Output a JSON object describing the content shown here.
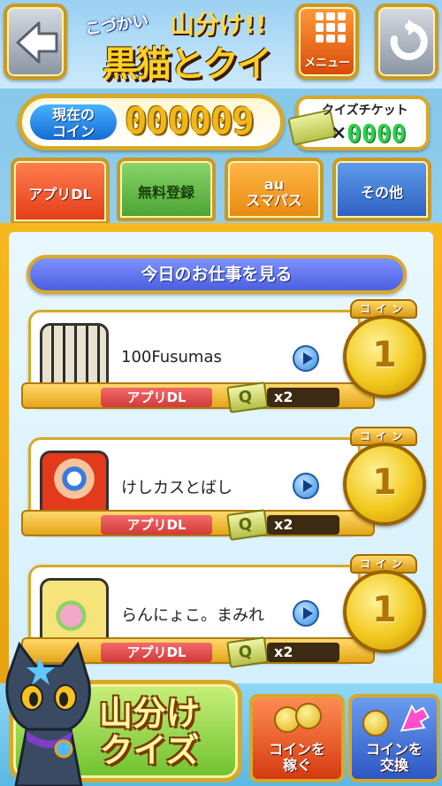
{
  "header": {
    "logo_sub": "こづかい",
    "logo_top": "山分け!!",
    "logo_main": "黒猫とクイズ",
    "menu_label": "メニュー"
  },
  "coins": {
    "label": "現在の\nコイン",
    "label_line1": "現在の",
    "label_line2": "コイン",
    "count": "000009"
  },
  "ticket": {
    "label": "クイズチケット",
    "prefix": "×",
    "count": "0000"
  },
  "tabs": [
    {
      "label": "アプリDL"
    },
    {
      "label": "無料登録"
    },
    {
      "label_line1": "au",
      "label_line2": "スマパス"
    },
    {
      "label": "その他"
    }
  ],
  "today_bar": "今日のお仕事を見る",
  "items": [
    {
      "name": "100Fusumas",
      "tag": "アプリDL",
      "ticket_letter": "Q",
      "reward": "x2",
      "coin_cap": "コイン",
      "coin_value": "1"
    },
    {
      "name": "けしカスとばし",
      "tag": "アプリDL",
      "ticket_letter": "Q",
      "reward": "x2",
      "coin_cap": "コイン",
      "coin_value": "1"
    },
    {
      "name": "らんにょこ。まみれ",
      "tag": "アプリDL",
      "ticket_letter": "Q",
      "reward": "x2",
      "coin_cap": "コイン",
      "coin_value": "1"
    }
  ],
  "footer": {
    "quiz_line1": "山分け",
    "quiz_line2": "クイズ",
    "earn_line1": "コインを",
    "earn_line2": "稼ぐ",
    "exchange_line1": "コインを",
    "exchange_line2": "交換"
  },
  "colors": {
    "gold": "#d7a92a",
    "tab_app": "#e33c18",
    "tab_free": "#4aa232",
    "tab_au": "#e88a10",
    "tab_other": "#2e5fc2",
    "ticket_count": "#2bd14b"
  },
  "icons": {
    "back": "back-arrow-icon",
    "menu": "grid-menu-icon",
    "reload": "reload-icon",
    "play": "play-icon",
    "ticket": "ticket-icon",
    "coin": "coin-icon",
    "mascot": "black-cat-mascot"
  }
}
